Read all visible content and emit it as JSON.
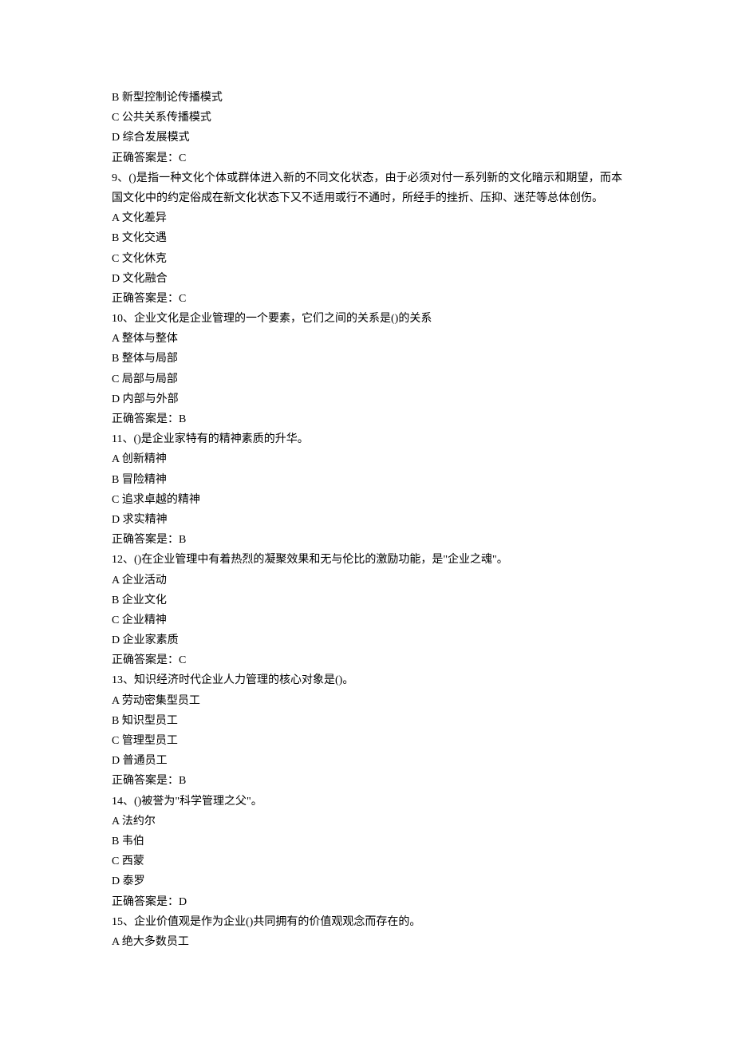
{
  "lines": [
    "B 新型控制论传播模式",
    "C 公共关系传播模式",
    "D 综合发展模式",
    "正确答案是：C",
    "9、()是指一种文化个体或群体进入新的不同文化状态，由于必须对付一系列新的文化暗示和期望，而本国文化中的约定俗成在新文化状态下又不适用或行不通时，所经手的挫折、压抑、迷茫等总体创伤。",
    "A 文化差异",
    "B 文化交遇",
    "C 文化休克",
    "D 文化融合",
    "正确答案是：C",
    "10、企业文化是企业管理的一个要素，它们之间的关系是()的关系",
    "A 整体与整体",
    "B 整体与局部",
    "C 局部与局部",
    "D 内部与外部",
    "正确答案是：B",
    "11、()是企业家特有的精神素质的升华。",
    "A 创新精神",
    "B 冒险精神",
    "C 追求卓越的精神",
    "D 求实精神",
    "正确答案是：B",
    "12、()在企业管理中有着热烈的凝聚效果和无与伦比的激励功能，是\"企业之魂\"。",
    "A 企业活动",
    "B 企业文化",
    "C 企业精神",
    "D 企业家素质",
    "正确答案是：C",
    "13、知识经济时代企业人力管理的核心对象是()。",
    "A 劳动密集型员工",
    "B 知识型员工",
    "C 管理型员工",
    "D 普通员工",
    "正确答案是：B",
    "14、()被誉为\"科学管理之父\"。",
    "A 法约尔",
    "B 韦伯",
    "C 西蒙",
    "D 泰罗",
    "正确答案是：D",
    "15、企业价值观是作为企业()共同拥有的价值观观念而存在的。",
    "A 绝大多数员工"
  ]
}
